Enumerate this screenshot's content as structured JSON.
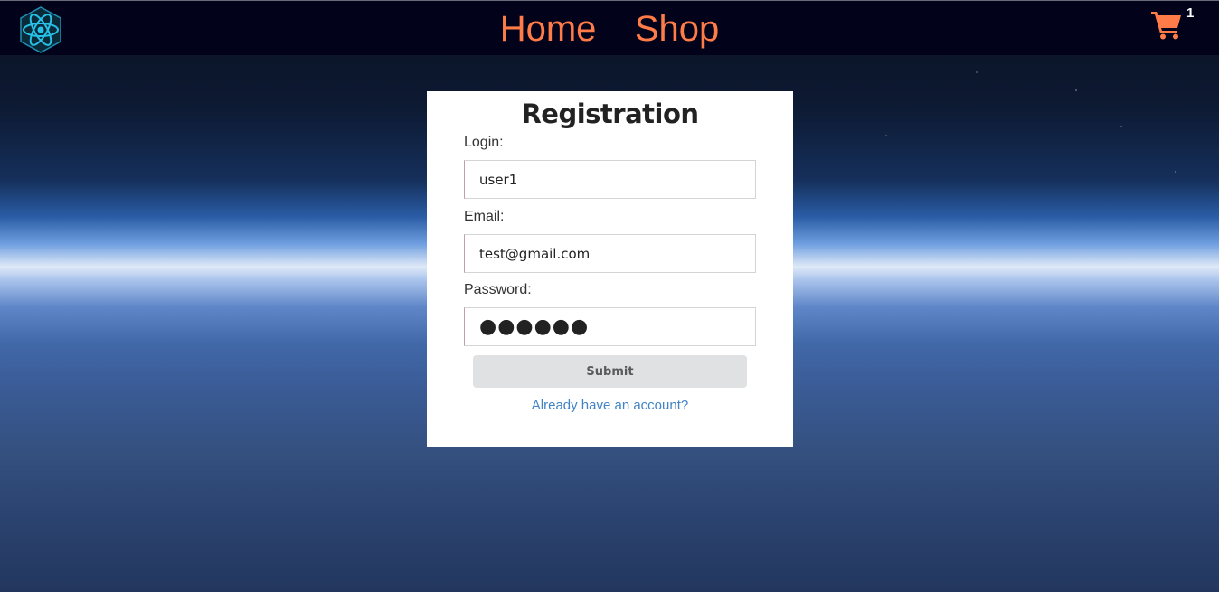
{
  "nav": {
    "logo_icon": "react-atom-icon",
    "links": [
      "Home",
      "Shop"
    ],
    "cart_icon": "shopping-cart-icon",
    "cart_count": "1",
    "link_color": "#ff7b47"
  },
  "form": {
    "title": "Registration",
    "login_label": "Login:",
    "login_value": "user1",
    "email_label": "Email:",
    "email_value": "test@gmail.com",
    "password_label": "Password:",
    "password_value": "●●●●●●",
    "submit_label": "Submit",
    "alt_link": "Already have an account?"
  }
}
